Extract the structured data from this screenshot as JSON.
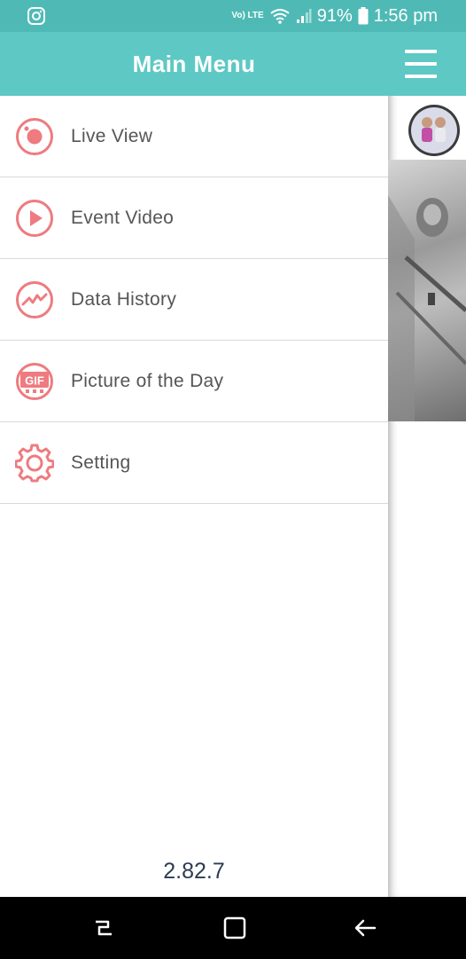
{
  "status_bar": {
    "volte_label": "Vo) LTE",
    "battery": "91%",
    "time": "1:56 pm"
  },
  "drawer": {
    "title": "Main Menu",
    "items": [
      {
        "label": "Live View",
        "icon": "live-view-icon"
      },
      {
        "label": "Event Video",
        "icon": "play-icon"
      },
      {
        "label": "Data History",
        "icon": "chart-icon"
      },
      {
        "label": "Picture of the Day",
        "icon": "gif-icon"
      },
      {
        "label": "Setting",
        "icon": "gear-icon"
      }
    ],
    "gif_text": "GIF",
    "version": "2.82.7"
  },
  "colors": {
    "status_bar": "#4fbab5",
    "header": "#5ec8c4",
    "accent_icon": "#ee7b7f"
  }
}
